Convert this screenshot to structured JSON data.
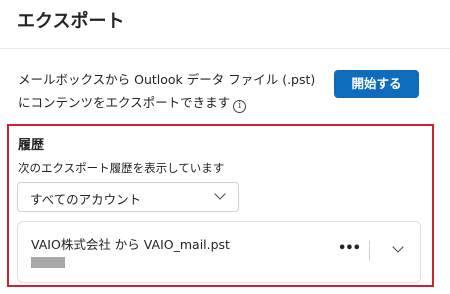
{
  "header": {
    "title": "エクスポート"
  },
  "export": {
    "description": "メールボックスから Outlook データ ファイル (.pst) にコンテンツをエクスポートできます",
    "info_icon": "info-icon",
    "start_button": "開始する"
  },
  "history": {
    "title": "履歴",
    "subtitle": "次のエクスポート履歴を表示しています",
    "account_filter": {
      "selected": "すべてのアカウント"
    },
    "items": [
      {
        "name": "VAIO株式会社 から VAIO_mail.pst"
      }
    ]
  },
  "colors": {
    "accent": "#0f6cbd",
    "highlight_border": "#d2202f"
  }
}
